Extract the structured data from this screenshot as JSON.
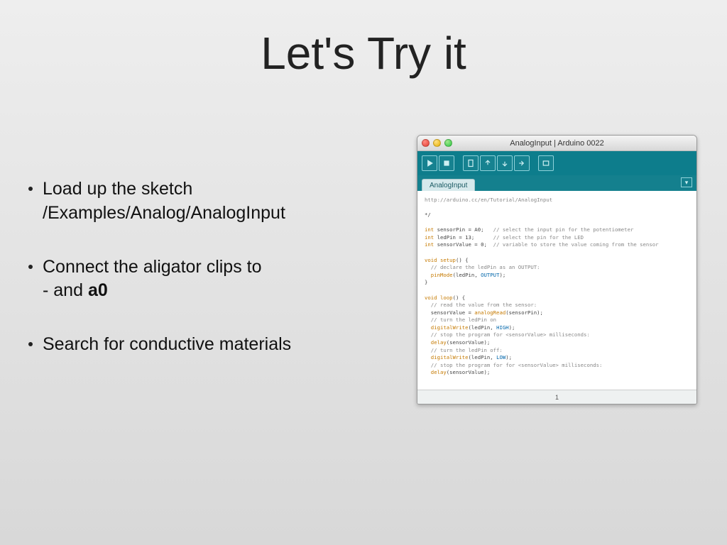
{
  "title": "Let's Try it",
  "bullets": {
    "b0": {
      "line1": "Load up the sketch",
      "line2": "/Examples/Analog/AnalogInput"
    },
    "b1": {
      "line1": "Connect the aligator clips to",
      "line2_pre": "- and ",
      "line2_bold": "a0"
    },
    "b2": {
      "line1": "Search for conductive materials"
    }
  },
  "window": {
    "title": "AnalogInput | Arduino 0022",
    "tab": "AnalogInput",
    "status": "1",
    "code": {
      "l0": "http://arduino.cc/en/Tutorial/AnalogInput",
      "l1": "*/",
      "l2a": "int",
      "l2b": " sensorPin = A0;   ",
      "l2c": "// select the input pin for the potentiometer",
      "l3a": "int",
      "l3b": " ledPin = 13;      ",
      "l3c": "// select the pin for the LED",
      "l4a": "int",
      "l4b": " sensorValue = 0;  ",
      "l4c": "// variable to store the value coming from the sensor",
      "l5a": "void",
      "l5b": " ",
      "l5c": "setup",
      "l5d": "() {",
      "l6": "  // declare the ledPin as an OUTPUT:",
      "l7a": "  ",
      "l7b": "pinMode",
      "l7c": "(ledPin, ",
      "l7d": "OUTPUT",
      "l7e": ");",
      "l8": "}",
      "l9a": "void",
      "l9b": " ",
      "l9c": "loop",
      "l9d": "() {",
      "l10": "  // read the value from the sensor:",
      "l11a": "  sensorValue = ",
      "l11b": "analogRead",
      "l11c": "(sensorPin);",
      "l12": "  // turn the ledPin on",
      "l13a": "  ",
      "l13b": "digitalWrite",
      "l13c": "(ledPin, ",
      "l13d": "HIGH",
      "l13e": ");",
      "l14": "  // stop the program for <sensorValue> milliseconds:",
      "l15a": "  ",
      "l15b": "delay",
      "l15c": "(sensorValue);",
      "l16": "  // turn the ledPin off:",
      "l17a": "  ",
      "l17b": "digitalWrite",
      "l17c": "(ledPin, ",
      "l17d": "LOW",
      "l17e": ");",
      "l18": "  // stop the program for for <sensorValue> milliseconds:",
      "l19a": "  ",
      "l19b": "delay",
      "l19c": "(sensorValue);",
      "l20": "}"
    }
  }
}
